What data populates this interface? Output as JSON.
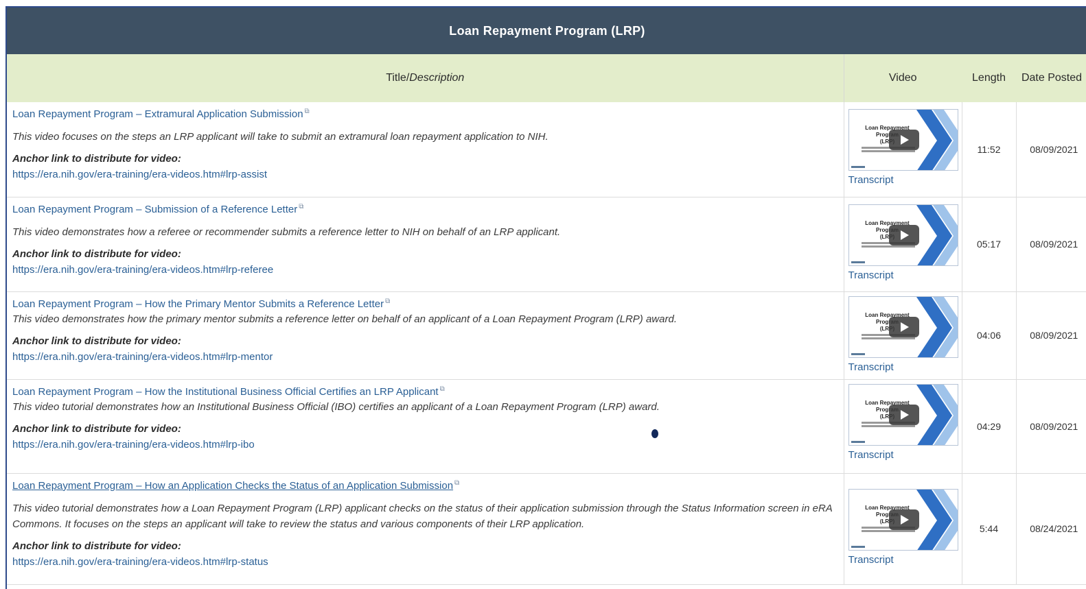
{
  "section_title": "Loan Repayment Program (LRP)",
  "columns": {
    "title": "Title/",
    "description": "Description",
    "video": "Video",
    "length": "Length",
    "date_posted": "Date Posted"
  },
  "anchor_label": "Anchor link to distribute for video:",
  "transcript_label": "Transcript",
  "thumbnail": {
    "line1": "Loan Repayment",
    "line2": "Program",
    "line3": "(LRP)"
  },
  "videos": [
    {
      "title": "Loan Repayment Program – Extramural Application Submission",
      "description": "This video focuses on the steps an LRP applicant will take to submit an extramural loan repayment application to NIH.",
      "url": "https://era.nih.gov/era-training/era-videos.htm#lrp-assist",
      "length": "11:52",
      "date": "08/09/2021"
    },
    {
      "title": "Loan Repayment Program – Submission of a Reference Letter",
      "description": "This video demonstrates how a referee or recommender submits a reference letter to NIH on behalf of an LRP applicant.",
      "url": "https://era.nih.gov/era-training/era-videos.htm#lrp-referee",
      "length": "05:17",
      "date": "08/09/2021"
    },
    {
      "title": "Loan Repayment Program – How the Primary Mentor Submits a Reference Letter",
      "description": "This video demonstrates how the primary mentor submits a reference letter on behalf of an applicant of a Loan Repayment Program (LRP) award.",
      "url": "https://era.nih.gov/era-training/era-videos.htm#lrp-mentor",
      "length": "04:06",
      "date": "08/09/2021"
    },
    {
      "title": "Loan Repayment Program – How the Institutional Business Official Certifies an LRP Applicant",
      "description": "This video tutorial demonstrates how an Institutional Business Official (IBO) certifies an applicant of a Loan Repayment Program (LRP) award.",
      "url": "https://era.nih.gov/era-training/era-videos.htm#lrp-ibo",
      "length": "04:29",
      "date": "08/09/2021"
    },
    {
      "title": "Loan Repayment Program – How an Application Checks the Status of an Application Submission",
      "description": "This video tutorial demonstrates how a Loan Repayment Program (LRP) applicant checks on the status of their application submission through the Status Information screen in eRA Commons.  It focuses on the steps an applicant will take to review the status and various components of their LRP application.",
      "url": "https://era.nih.gov/era-training/era-videos.htm#lrp-status",
      "length": "5:44",
      "date": "08/24/2021"
    }
  ]
}
